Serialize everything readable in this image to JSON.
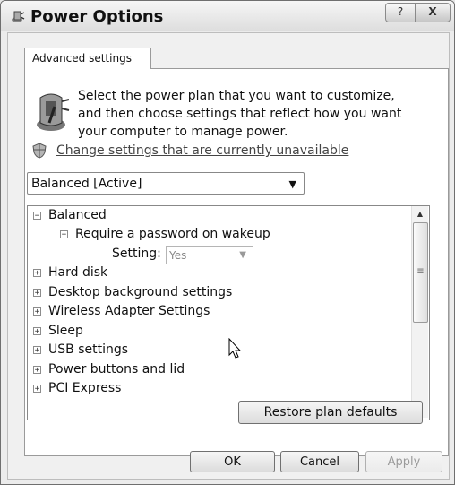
{
  "window": {
    "title": "Power Options",
    "help_label": "?",
    "close_label": "X"
  },
  "tab": {
    "label": "Advanced settings"
  },
  "intro": {
    "text": "Select the power plan that you want to customize, and then choose settings that reflect how you want your computer to manage power."
  },
  "link": {
    "text": "Change settings that are currently unavailable"
  },
  "plan_select": {
    "value": "Balanced [Active]",
    "arrow": "▼"
  },
  "tree": {
    "root": {
      "expander": "−",
      "label": "Balanced"
    },
    "password": {
      "expander": "−",
      "label": "Require a password on wakeup"
    },
    "setting": {
      "label": "Setting:",
      "value": "Yes",
      "arrow": "▼"
    },
    "items": [
      {
        "expander": "+",
        "label": "Hard disk"
      },
      {
        "expander": "+",
        "label": "Desktop background settings"
      },
      {
        "expander": "+",
        "label": "Wireless Adapter Settings"
      },
      {
        "expander": "+",
        "label": "Sleep"
      },
      {
        "expander": "+",
        "label": "USB settings"
      },
      {
        "expander": "+",
        "label": "Power buttons and lid"
      },
      {
        "expander": "+",
        "label": "PCI Express"
      }
    ],
    "scroll_up": "▲",
    "scroll_grip": "≡",
    "scroll_down": "▼"
  },
  "buttons": {
    "restore": "Restore plan defaults",
    "ok": "OK",
    "cancel": "Cancel",
    "apply": "Apply"
  }
}
